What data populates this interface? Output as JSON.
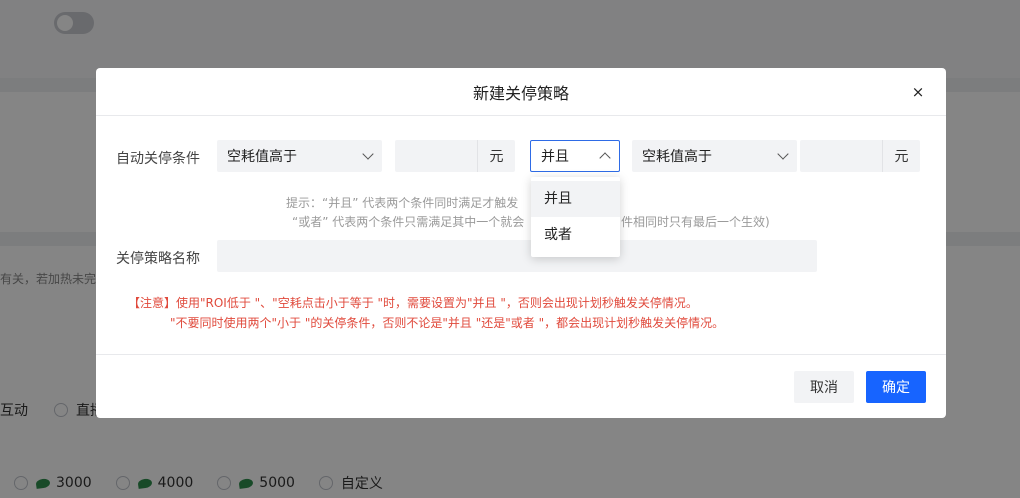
{
  "background": {
    "hint_text": "有关，若加热未完",
    "radio_row": [
      "互动",
      "直播"
    ],
    "amounts": [
      "3000",
      "4000",
      "5000",
      "自定义"
    ]
  },
  "modal": {
    "title": "新建关停策略",
    "close_label": "×",
    "condition_label": "自动关停条件",
    "condition1": {
      "selected": "空耗值高于",
      "value": "",
      "unit": "元"
    },
    "logic_select": {
      "selected": "并且"
    },
    "condition2": {
      "selected": "空耗值高于",
      "value": "",
      "unit": "元"
    },
    "tip_line1": "提示：“并且” 代表两个条件同时满足才触发",
    "tip_line2": "“或者” 代表两个条件只需满足其中一个就会",
    "tip_line2_tail": "件相同时只有最后一个生效)",
    "name_label": "关停策略名称",
    "name_value": "",
    "warning_line1": "【注意】使用\"ROI低于 \"、\"空耗点击小于等于 \"时，需要设置为\"并且 \"，否则会出现计划秒触发关停情况。",
    "warning_line2": "\"不要同时使用两个\"小于 \"的关停条件，否则不论是\"并且 \"还是\"或者 \"，都会出现计划秒触发关停情况。",
    "cancel_label": "取消",
    "confirm_label": "确定"
  },
  "dropdown": {
    "options": [
      "并且",
      "或者"
    ],
    "selected": "并且"
  },
  "colors": {
    "primary": "#1764ff",
    "warning": "#e04a3c",
    "active_border": "#2e6be6"
  }
}
